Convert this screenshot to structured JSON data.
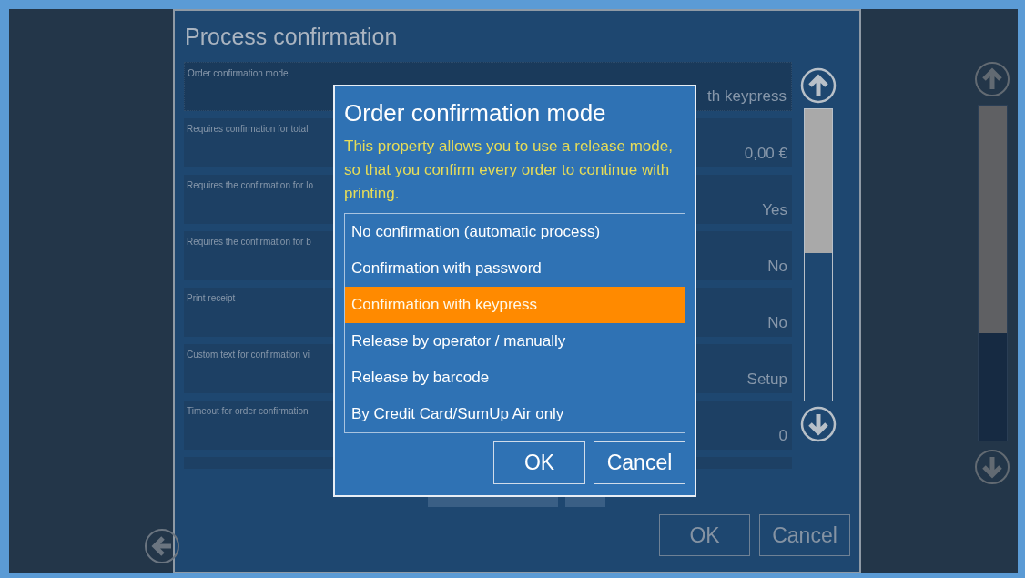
{
  "page": {
    "title": "Process confirmation"
  },
  "rows": [
    {
      "label": "Order confirmation mode",
      "value": "th keypress",
      "selected": true
    },
    {
      "label": "Requires confirmation for total",
      "value": "0,00 €",
      "selected": false
    },
    {
      "label": "Requires the confirmation for lo",
      "value": "Yes",
      "selected": false
    },
    {
      "label": "Requires the confirmation for b",
      "value": "No",
      "selected": false
    },
    {
      "label": "Print receipt",
      "value": "No",
      "selected": false
    },
    {
      "label": "Custom text for confirmation vi",
      "value": "Setup",
      "selected": false
    },
    {
      "label": "Timeout for order confirmation",
      "value": "0",
      "selected": false
    }
  ],
  "buttons": [
    "OK",
    "Cancel"
  ],
  "dialog": {
    "title": "Order confirmation mode",
    "description": "This property allows you to use a release mode, so that you confirm every order to continue with printing.",
    "options": [
      {
        "label": "No confirmation (automatic process)",
        "selected": false
      },
      {
        "label": "Confirmation with password",
        "selected": false
      },
      {
        "label": "Confirmation with keypress",
        "selected": true
      },
      {
        "label": "Release by operator / manually",
        "selected": false
      },
      {
        "label": "Release by barcode",
        "selected": false
      },
      {
        "label": "By Credit Card/SumUp Air only",
        "selected": false
      }
    ],
    "buttons": [
      "OK",
      "Cancel"
    ]
  }
}
